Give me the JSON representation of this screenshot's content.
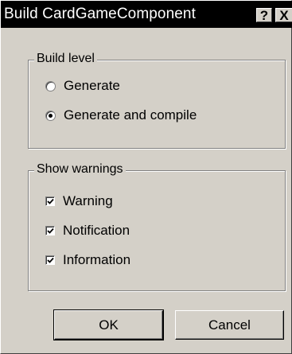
{
  "window": {
    "title": "Build CardGameComponent",
    "help_button": "?",
    "close_button": "X"
  },
  "build_level": {
    "label": "Build level",
    "options": [
      {
        "label": "Generate",
        "selected": false
      },
      {
        "label": "Generate and compile",
        "selected": true
      }
    ]
  },
  "show_warnings": {
    "label": "Show warnings",
    "options": [
      {
        "label": "Warning",
        "checked": true
      },
      {
        "label": "Notification",
        "checked": true
      },
      {
        "label": "Information",
        "checked": true
      }
    ]
  },
  "buttons": {
    "ok": "OK",
    "cancel": "Cancel"
  }
}
